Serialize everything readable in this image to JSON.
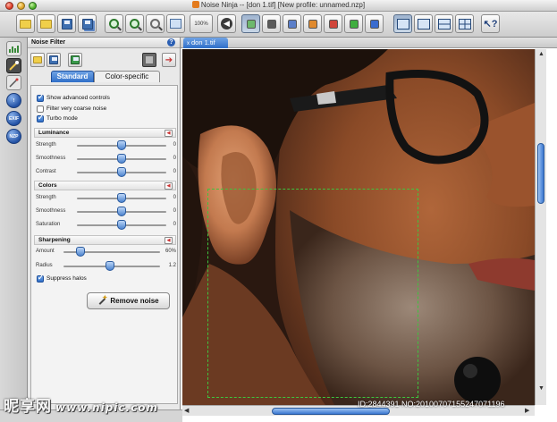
{
  "window": {
    "title": "Noise Ninja -- [don 1.tif] [New profile: unnamed.nzp]"
  },
  "toolbar": {
    "zoom_label": "100%",
    "buttons": [
      "open-folder",
      "open-folder-2",
      "save",
      "save-as",
      "zoom-in",
      "zoom-out",
      "zoom-tool",
      "fit-window",
      "zoom-100",
      "back",
      "preview-green",
      "preview-gray",
      "channel-blue",
      "channel-orange",
      "channel-red",
      "channel-green",
      "channel-blue-2",
      "layout-single",
      "layout-split-v",
      "layout-split-h",
      "layout-quad",
      "help"
    ]
  },
  "panel": {
    "title": "Noise Filter",
    "help": "?",
    "tabs": [
      "Standard",
      "Color-specific"
    ],
    "active_tab": "Standard",
    "checkboxes": [
      {
        "label": "Show advanced controls",
        "checked": true
      },
      {
        "label": "Filter very coarse noise",
        "checked": false
      },
      {
        "label": "Turbo mode",
        "checked": true
      }
    ],
    "sections": {
      "luminance": {
        "title": "Luminance",
        "sliders": [
          {
            "label": "Strength",
            "value": "0",
            "position": 0.5
          },
          {
            "label": "Smoothness",
            "value": "0",
            "position": 0.5
          },
          {
            "label": "Contrast",
            "value": "0",
            "position": 0.5
          }
        ]
      },
      "colors": {
        "title": "Colors",
        "sliders": [
          {
            "label": "Strength",
            "value": "0",
            "position": 0.5
          },
          {
            "label": "Smoothness",
            "value": "0",
            "position": 0.5
          },
          {
            "label": "Saturation",
            "value": "0",
            "position": 0.5
          }
        ]
      },
      "sharpening": {
        "title": "Sharpening",
        "sliders": [
          {
            "label": "Amount",
            "value": "60%",
            "position": 0.12
          },
          {
            "label": "Radius",
            "value": "1.2",
            "position": 0.5
          }
        ],
        "suppress_halos": {
          "label": "Suppress halos",
          "checked": true
        }
      }
    },
    "remove_button": "Remove noise"
  },
  "document": {
    "tab_label": "don 1.tif",
    "tab_close": "x"
  },
  "watermark": {
    "left_brand": "昵享网",
    "left_url": "www.nipic.com",
    "right_id": "ID:2844391 NO:20100707155247071196"
  },
  "colors": {
    "accent": "#2f6fc9",
    "selection": "#3ec43e"
  }
}
